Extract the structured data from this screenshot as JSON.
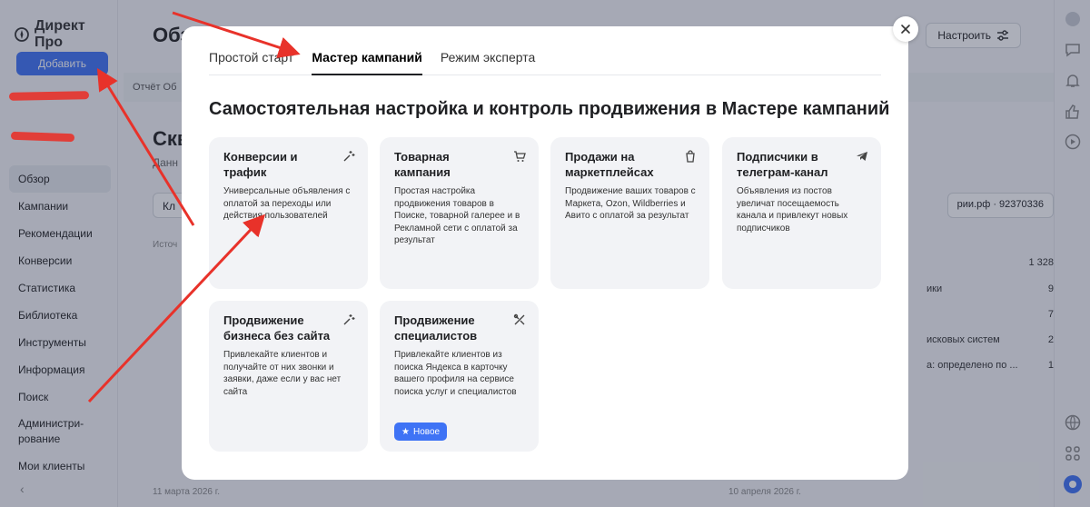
{
  "app": {
    "logo": "Директ Про",
    "add_button": "Добавить",
    "page_title": "Обз",
    "setup_button": "Настроить",
    "report_strip": "Отчёт  Об",
    "section_title": "Скв",
    "section_sub": "Данн",
    "chip": "Кл",
    "source_label": "Источ",
    "site_selector": "рии.рф · 92370336",
    "date_left": "11 марта 2026 г.",
    "date_right": "10 апреля 2026 г.",
    "stats": [
      {
        "label": "",
        "value": "1 328"
      },
      {
        "label": "ики",
        "value": "9"
      },
      {
        "label": "",
        "value": "7"
      },
      {
        "label": "исковых систем",
        "value": "2"
      },
      {
        "label": "а: определено по ...",
        "value": "1"
      }
    ]
  },
  "sidebar": {
    "items": [
      {
        "label": "Обзор"
      },
      {
        "label": "Кампании"
      },
      {
        "label": "Рекомендации"
      },
      {
        "label": "Конверсии"
      },
      {
        "label": "Статистика"
      },
      {
        "label": "Библиотека"
      },
      {
        "label": "Инструменты"
      },
      {
        "label": "Информация"
      },
      {
        "label": "Поиск"
      },
      {
        "label": "Администри-\nрование"
      },
      {
        "label": "Мои клиенты"
      }
    ]
  },
  "modal": {
    "tabs": [
      {
        "label": "Простой старт"
      },
      {
        "label": "Мастер кампаний"
      },
      {
        "label": "Режим эксперта"
      }
    ],
    "title": "Самостоятельная настройка и контроль продвижения в Мастере кампаний",
    "cards": [
      {
        "title": "Конверсии и трафик",
        "desc": "Универсальные объявления с оплатой за переходы или действия пользователей",
        "icon": "magic-wand-icon"
      },
      {
        "title": "Товарная кампания",
        "desc": "Простая настройка продвижения товаров в Поиске, товарной галерее и в Рекламной сети с оплатой за результат",
        "icon": "cart-icon"
      },
      {
        "title": "Продажи на маркетплейсах",
        "desc": "Продвижение ваших товаров с Маркета, Ozon, Wildberries и Авито с оплатой за результат",
        "icon": "shopping-bag-icon"
      },
      {
        "title": "Подписчики в телеграм-канал",
        "desc": "Объявления из постов увеличат посещаемость канала и привлекут новых подписчиков",
        "icon": "telegram-icon"
      },
      {
        "title": "Продвижение бизнеса без сайта",
        "desc": "Привлекайте клиентов и получайте от них звонки и заявки, даже если у вас нет сайта",
        "icon": "magic-wand-icon"
      },
      {
        "title": "Продвижение специалистов",
        "desc": "Привлекайте клиентов из поиска Яндекса в карточку вашего профиля на сервисе поиска услуг и специалистов",
        "icon": "tools-icon",
        "badge": "Новое"
      }
    ]
  },
  "colors": {
    "accent": "#3f73f5",
    "annotation": "#e8322a",
    "card_bg": "#f2f3f6"
  }
}
